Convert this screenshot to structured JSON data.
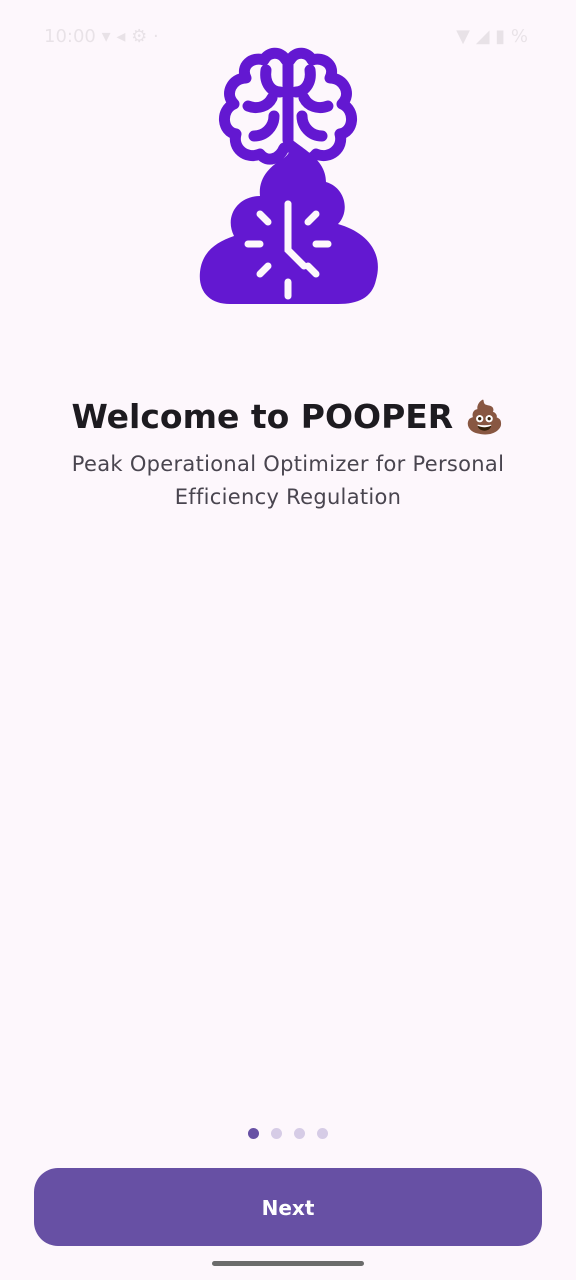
{
  "status_bar": {
    "left_text": "10:00 ▾ ◂ ⚙ ·",
    "right_text": "▼ ◢ ▮ %"
  },
  "logo": {
    "icon": "brain-poop-clock-icon",
    "color": "#6318d1"
  },
  "welcome": {
    "title": "Welcome to POOPER",
    "title_emoji": "💩",
    "subtitle": "Peak Operational Optimizer for Personal Efficiency Regulation"
  },
  "pager": {
    "total": 4,
    "current": 1
  },
  "actions": {
    "next_label": "Next"
  },
  "colors": {
    "background": "#fdf7fc",
    "primary": "#6750a4",
    "dot_inactive": "#d6cce6"
  }
}
